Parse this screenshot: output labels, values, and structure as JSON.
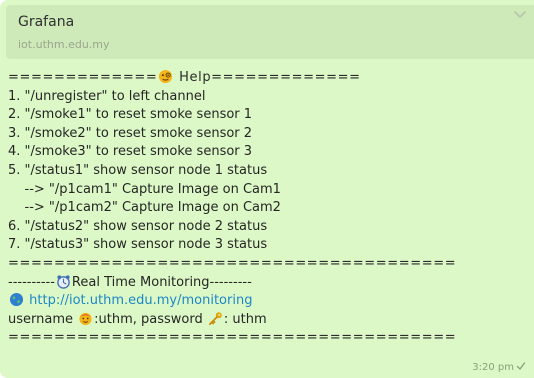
{
  "message": {
    "preview": {
      "title": "Grafana",
      "domain": "iot.uthm.edu.my",
      "chevron_icon": "chevron-down-icon"
    },
    "lines": {
      "l1_a": "=============",
      "l1_b": " Help=============",
      "l2": "1. \"/unregister\" to left channel",
      "l3": "2. \"/smoke1\" to reset smoke sensor 1",
      "l4": "3. \"/smoke2\" to reset smoke sensor 2",
      "l5": "4. \"/smoke3\" to reset smoke sensor 3",
      "l6": "5. \"/status1\" show sensor node 1 status",
      "l7": "    --> \"/p1cam1\" Capture Image on Cam1",
      "l8": "    --> \"/p1cam2\" Capture Image on Cam2",
      "l9": "6. \"/status2\" show sensor node 2 status",
      "l10": "7. \"/status3\" show sensor node 3 status",
      "l11": "=======================================",
      "l12_a": "----------",
      "l12_b": "Real Time Monitoring---------",
      "l13_url": "http://iot.uthm.edu.my/monitoring",
      "l14_a": "username ",
      "l14_b": ":uthm, password ",
      "l14_c": ": uthm",
      "l15": "======================================="
    },
    "icons": {
      "monocle": "monocle-face-icon",
      "alarm": "alarm-clock-icon",
      "globe": "globe-icon",
      "face": "face-icon",
      "key": "key-icon"
    },
    "time": "3:20 pm",
    "status_icon": "single-check-icon"
  }
}
